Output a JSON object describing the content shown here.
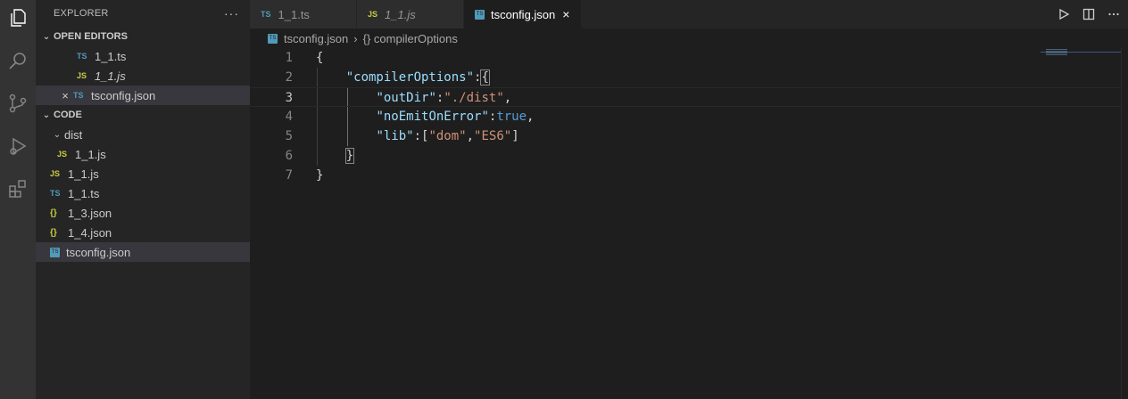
{
  "sidebar": {
    "title": "EXPLORER",
    "more": "···",
    "open_editors": {
      "label": "OPEN EDITORS",
      "items": [
        {
          "icon": "TS",
          "name": "1_1.ts"
        },
        {
          "icon": "JS",
          "name": "1_1.js"
        },
        {
          "icon": "TS",
          "name": "tsconfig.json",
          "close": "×"
        }
      ]
    },
    "code": {
      "label": "CODE",
      "folder": "dist",
      "folder_items": [
        {
          "icon": "JS",
          "name": "1_1.js"
        }
      ],
      "items": [
        {
          "icon": "JS",
          "name": "1_1.js"
        },
        {
          "icon": "TS",
          "name": "1_1.ts"
        },
        {
          "icon": "{}",
          "name": "1_3.json"
        },
        {
          "icon": "{}",
          "name": "1_4.json"
        },
        {
          "icon": "TS",
          "name": "tsconfig.json"
        }
      ]
    }
  },
  "tabs": [
    {
      "icon": "TS",
      "label": "1_1.ts"
    },
    {
      "icon": "JS",
      "label": "1_1.js"
    },
    {
      "icon": "TS",
      "label": "tsconfig.json",
      "close": "×"
    }
  ],
  "breadcrumb": {
    "file": "tsconfig.json",
    "sep": "›",
    "symbol": "{} compilerOptions"
  },
  "editor": {
    "line_numbers": [
      "1",
      "2",
      "3",
      "4",
      "5",
      "6",
      "7"
    ],
    "current_line": 3,
    "lines": [
      {
        "indent": "",
        "parts": [
          {
            "t": "{",
            "c": ""
          }
        ]
      },
      {
        "indent": "    ",
        "parts": [
          {
            "t": "\"compilerOptions\"",
            "c": "k"
          },
          {
            "t": ":",
            "c": ""
          },
          {
            "t": "{",
            "c": "hl"
          }
        ]
      },
      {
        "indent": "        ",
        "parts": [
          {
            "t": "\"outDir\"",
            "c": "k"
          },
          {
            "t": ":",
            "c": ""
          },
          {
            "t": "\"./dist\"",
            "c": "s"
          },
          {
            "t": ",",
            "c": ""
          }
        ]
      },
      {
        "indent": "        ",
        "parts": [
          {
            "t": "\"noEmitOnError\"",
            "c": "k"
          },
          {
            "t": ":",
            "c": ""
          },
          {
            "t": "true",
            "c": "b"
          },
          {
            "t": ",",
            "c": ""
          }
        ]
      },
      {
        "indent": "        ",
        "parts": [
          {
            "t": "\"lib\"",
            "c": "k"
          },
          {
            "t": ":[",
            "c": ""
          },
          {
            "t": "\"dom\"",
            "c": "s"
          },
          {
            "t": ",",
            "c": ""
          },
          {
            "t": "\"ES6\"",
            "c": "s"
          },
          {
            "t": "]",
            "c": ""
          }
        ]
      },
      {
        "indent": "    ",
        "parts": [
          {
            "t": "}",
            "c": "hl"
          }
        ]
      },
      {
        "indent": "",
        "parts": [
          {
            "t": "}",
            "c": ""
          }
        ]
      }
    ]
  },
  "colors": {
    "ts": "#519aba",
    "js": "#cbcb41",
    "key": "#9cdcfe",
    "string": "#ce9178",
    "bool": "#569cd6"
  }
}
